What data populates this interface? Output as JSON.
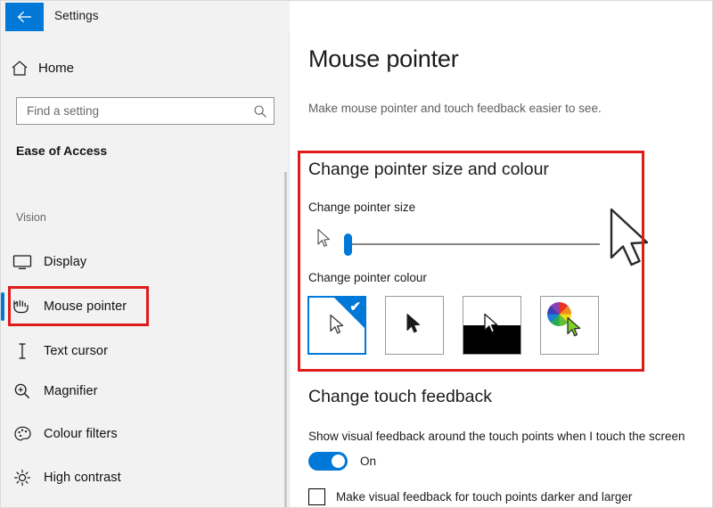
{
  "window": {
    "title": "Settings",
    "back_icon": "back-arrow-icon"
  },
  "sidebar": {
    "home": {
      "label": "Home",
      "icon": "home-icon"
    },
    "search": {
      "placeholder": "Find a setting",
      "value": "",
      "icon": "search-icon"
    },
    "category": "Ease of Access",
    "group_label": "Vision",
    "items": [
      {
        "label": "Display",
        "icon": "monitor-icon",
        "selected": false
      },
      {
        "label": "Mouse pointer",
        "icon": "mouse-pointer-icon",
        "selected": true
      },
      {
        "label": "Text cursor",
        "icon": "text-cursor-icon",
        "selected": false
      },
      {
        "label": "Magnifier",
        "icon": "magnifier-icon",
        "selected": false
      },
      {
        "label": "Colour filters",
        "icon": "palette-icon",
        "selected": false
      },
      {
        "label": "High contrast",
        "icon": "brightness-icon",
        "selected": false
      }
    ]
  },
  "main": {
    "title": "Mouse pointer",
    "subtitle": "Make mouse pointer and touch feedback easier to see.",
    "section_pointer": {
      "heading": "Change pointer size and colour",
      "size_label": "Change pointer size",
      "slider": {
        "value": 1,
        "min": 1,
        "max": 15
      },
      "colour_label": "Change pointer colour",
      "swatches": [
        {
          "name": "white-pointer",
          "selected": true,
          "check_icon": "check-icon"
        },
        {
          "name": "black-pointer",
          "selected": false,
          "check_icon": ""
        },
        {
          "name": "inverted-pointer",
          "selected": false,
          "check_icon": ""
        },
        {
          "name": "custom-pointer",
          "selected": false,
          "check_icon": ""
        }
      ]
    },
    "section_touch": {
      "heading": "Change touch feedback",
      "toggle_label": "Show visual feedback around the touch points when I touch the screen",
      "toggle_state": "On",
      "checkbox_label": "Make visual feedback for touch points darker and larger",
      "checkbox_checked": false
    }
  },
  "annotations": {
    "highlight_color": "#e01b1b",
    "boxes": [
      {
        "name": "mouse-pointer-nav-highlight"
      },
      {
        "name": "pointer-section-highlight"
      }
    ]
  },
  "colors": {
    "accent": "#0078d7",
    "sidebar_bg": "#f2f2f2",
    "highlight": "#e01b1b"
  }
}
